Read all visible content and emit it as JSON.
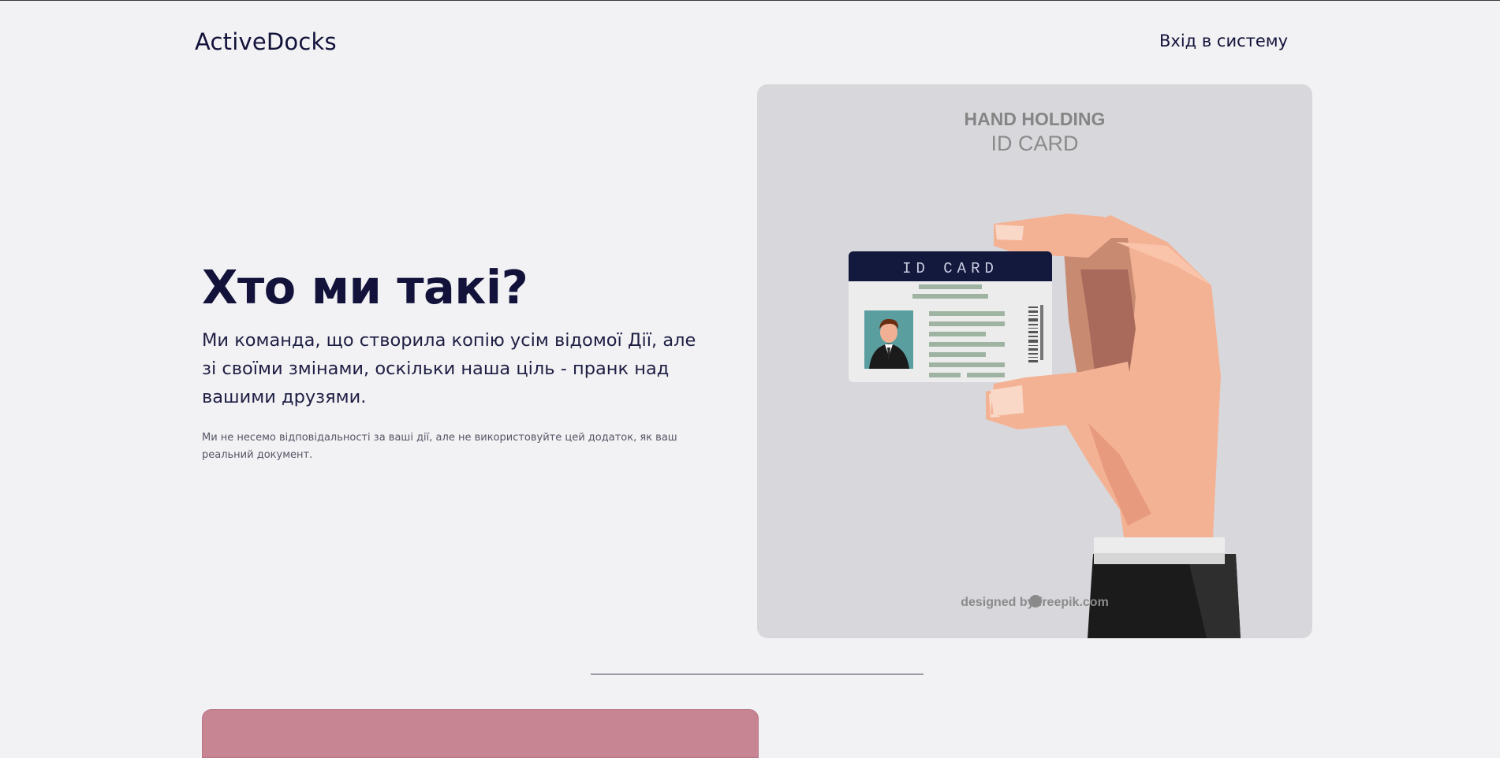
{
  "header": {
    "logo": "ActiveDocks",
    "login_label": "Вхід в систему"
  },
  "hero": {
    "title": "Хто ми такі?",
    "lead": "Ми команда, що створила копію усім відомої Дії, але зі своїми змінами, оскільки наша ціль - пранк над вашими друзями.",
    "note": "Ми не несемо відповідальності за ваші дії, але не використовуйте цей додаток, як ваш реальний документ."
  },
  "illustration": {
    "heading_line1": "HAND HOLDING",
    "heading_line2": "ID CARD",
    "card_header": "ID CARD",
    "credit": "designed by  freepik.com"
  },
  "colors": {
    "background": "#f2f2f4",
    "text": "#12123a",
    "illustration_bg": "#d8d8dc",
    "skin": "#f4b295",
    "card_header": "#13193d",
    "bottom_card": "#c78594"
  }
}
